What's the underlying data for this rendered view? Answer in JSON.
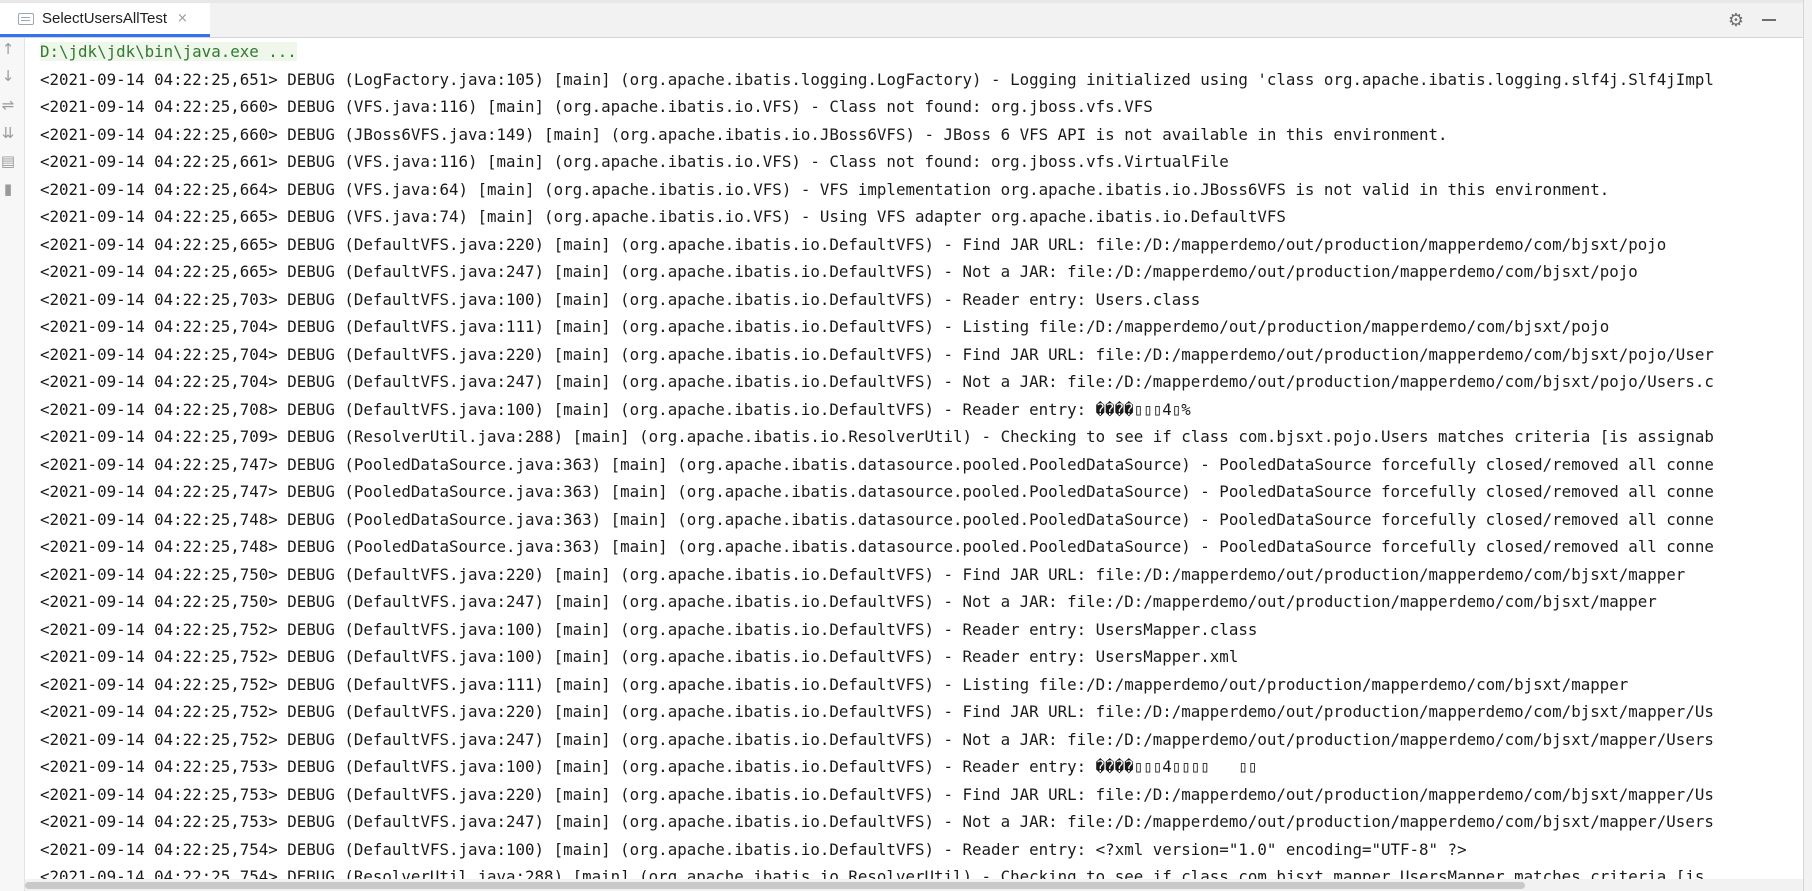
{
  "tab": {
    "title": "SelectUsersAllTest",
    "close": "×"
  },
  "actions": {
    "settings_icon": "gear-icon",
    "minimize_icon": "minimize-icon"
  },
  "toolbar": {
    "icons": [
      "up-arrow-icon",
      "down-arrow-icon",
      "soft-wrap-icon",
      "scroll-to-end-icon",
      "print-icon",
      "trash-icon"
    ]
  },
  "console": {
    "command": "D:\\jdk\\jdk\\bin\\java.exe ...",
    "lines": [
      "<2021-09-14 04:22:25,651> DEBUG (LogFactory.java:105) [main] (org.apache.ibatis.logging.LogFactory) - Logging initialized using 'class org.apache.ibatis.logging.slf4j.Slf4jImpl",
      "<2021-09-14 04:22:25,660> DEBUG (VFS.java:116) [main] (org.apache.ibatis.io.VFS) - Class not found: org.jboss.vfs.VFS",
      "<2021-09-14 04:22:25,660> DEBUG (JBoss6VFS.java:149) [main] (org.apache.ibatis.io.JBoss6VFS) - JBoss 6 VFS API is not available in this environment.",
      "<2021-09-14 04:22:25,661> DEBUG (VFS.java:116) [main] (org.apache.ibatis.io.VFS) - Class not found: org.jboss.vfs.VirtualFile",
      "<2021-09-14 04:22:25,664> DEBUG (VFS.java:64) [main] (org.apache.ibatis.io.VFS) - VFS implementation org.apache.ibatis.io.JBoss6VFS is not valid in this environment.",
      "<2021-09-14 04:22:25,665> DEBUG (VFS.java:74) [main] (org.apache.ibatis.io.VFS) - Using VFS adapter org.apache.ibatis.io.DefaultVFS",
      "<2021-09-14 04:22:25,665> DEBUG (DefaultVFS.java:220) [main] (org.apache.ibatis.io.DefaultVFS) - Find JAR URL: file:/D:/mapperdemo/out/production/mapperdemo/com/bjsxt/pojo",
      "<2021-09-14 04:22:25,665> DEBUG (DefaultVFS.java:247) [main] (org.apache.ibatis.io.DefaultVFS) - Not a JAR: file:/D:/mapperdemo/out/production/mapperdemo/com/bjsxt/pojo",
      "<2021-09-14 04:22:25,703> DEBUG (DefaultVFS.java:100) [main] (org.apache.ibatis.io.DefaultVFS) - Reader entry: Users.class",
      "<2021-09-14 04:22:25,704> DEBUG (DefaultVFS.java:111) [main] (org.apache.ibatis.io.DefaultVFS) - Listing file:/D:/mapperdemo/out/production/mapperdemo/com/bjsxt/pojo",
      "<2021-09-14 04:22:25,704> DEBUG (DefaultVFS.java:220) [main] (org.apache.ibatis.io.DefaultVFS) - Find JAR URL: file:/D:/mapperdemo/out/production/mapperdemo/com/bjsxt/pojo/User",
      "<2021-09-14 04:22:25,704> DEBUG (DefaultVFS.java:247) [main] (org.apache.ibatis.io.DefaultVFS) - Not a JAR: file:/D:/mapperdemo/out/production/mapperdemo/com/bjsxt/pojo/Users.c",
      "<2021-09-14 04:22:25,708> DEBUG (DefaultVFS.java:100) [main] (org.apache.ibatis.io.DefaultVFS) - Reader entry: ����▯▯▯4▯%",
      "<2021-09-14 04:22:25,709> DEBUG (ResolverUtil.java:288) [main] (org.apache.ibatis.io.ResolverUtil) - Checking to see if class com.bjsxt.pojo.Users matches criteria [is assignab",
      "<2021-09-14 04:22:25,747> DEBUG (PooledDataSource.java:363) [main] (org.apache.ibatis.datasource.pooled.PooledDataSource) - PooledDataSource forcefully closed/removed all conne",
      "<2021-09-14 04:22:25,747> DEBUG (PooledDataSource.java:363) [main] (org.apache.ibatis.datasource.pooled.PooledDataSource) - PooledDataSource forcefully closed/removed all conne",
      "<2021-09-14 04:22:25,748> DEBUG (PooledDataSource.java:363) [main] (org.apache.ibatis.datasource.pooled.PooledDataSource) - PooledDataSource forcefully closed/removed all conne",
      "<2021-09-14 04:22:25,748> DEBUG (PooledDataSource.java:363) [main] (org.apache.ibatis.datasource.pooled.PooledDataSource) - PooledDataSource forcefully closed/removed all conne",
      "<2021-09-14 04:22:25,750> DEBUG (DefaultVFS.java:220) [main] (org.apache.ibatis.io.DefaultVFS) - Find JAR URL: file:/D:/mapperdemo/out/production/mapperdemo/com/bjsxt/mapper",
      "<2021-09-14 04:22:25,750> DEBUG (DefaultVFS.java:247) [main] (org.apache.ibatis.io.DefaultVFS) - Not a JAR: file:/D:/mapperdemo/out/production/mapperdemo/com/bjsxt/mapper",
      "<2021-09-14 04:22:25,752> DEBUG (DefaultVFS.java:100) [main] (org.apache.ibatis.io.DefaultVFS) - Reader entry: UsersMapper.class",
      "<2021-09-14 04:22:25,752> DEBUG (DefaultVFS.java:100) [main] (org.apache.ibatis.io.DefaultVFS) - Reader entry: UsersMapper.xml",
      "<2021-09-14 04:22:25,752> DEBUG (DefaultVFS.java:111) [main] (org.apache.ibatis.io.DefaultVFS) - Listing file:/D:/mapperdemo/out/production/mapperdemo/com/bjsxt/mapper",
      "<2021-09-14 04:22:25,752> DEBUG (DefaultVFS.java:220) [main] (org.apache.ibatis.io.DefaultVFS) - Find JAR URL: file:/D:/mapperdemo/out/production/mapperdemo/com/bjsxt/mapper/Us",
      "<2021-09-14 04:22:25,752> DEBUG (DefaultVFS.java:247) [main] (org.apache.ibatis.io.DefaultVFS) - Not a JAR: file:/D:/mapperdemo/out/production/mapperdemo/com/bjsxt/mapper/Users",
      "<2021-09-14 04:22:25,753> DEBUG (DefaultVFS.java:100) [main] (org.apache.ibatis.io.DefaultVFS) - Reader entry: ����▯▯▯4▯▯▯▯   ▯▯",
      "<2021-09-14 04:22:25,753> DEBUG (DefaultVFS.java:220) [main] (org.apache.ibatis.io.DefaultVFS) - Find JAR URL: file:/D:/mapperdemo/out/production/mapperdemo/com/bjsxt/mapper/Us",
      "<2021-09-14 04:22:25,753> DEBUG (DefaultVFS.java:247) [main] (org.apache.ibatis.io.DefaultVFS) - Not a JAR: file:/D:/mapperdemo/out/production/mapperdemo/com/bjsxt/mapper/Users",
      "<2021-09-14 04:22:25,754> DEBUG (DefaultVFS.java:100) [main] (org.apache.ibatis.io.DefaultVFS) - Reader entry: <?xml version=\"1.0\" encoding=\"UTF-8\" ?>",
      "<2021-09-14 04:22:25,754> DEBUG (ResolverUtil.java:288) [main] (org.apache.ibatis.io.ResolverUtil) - Checking to see if class com.bjsxt.mapper.UsersMapper matches criteria [is"
    ]
  }
}
